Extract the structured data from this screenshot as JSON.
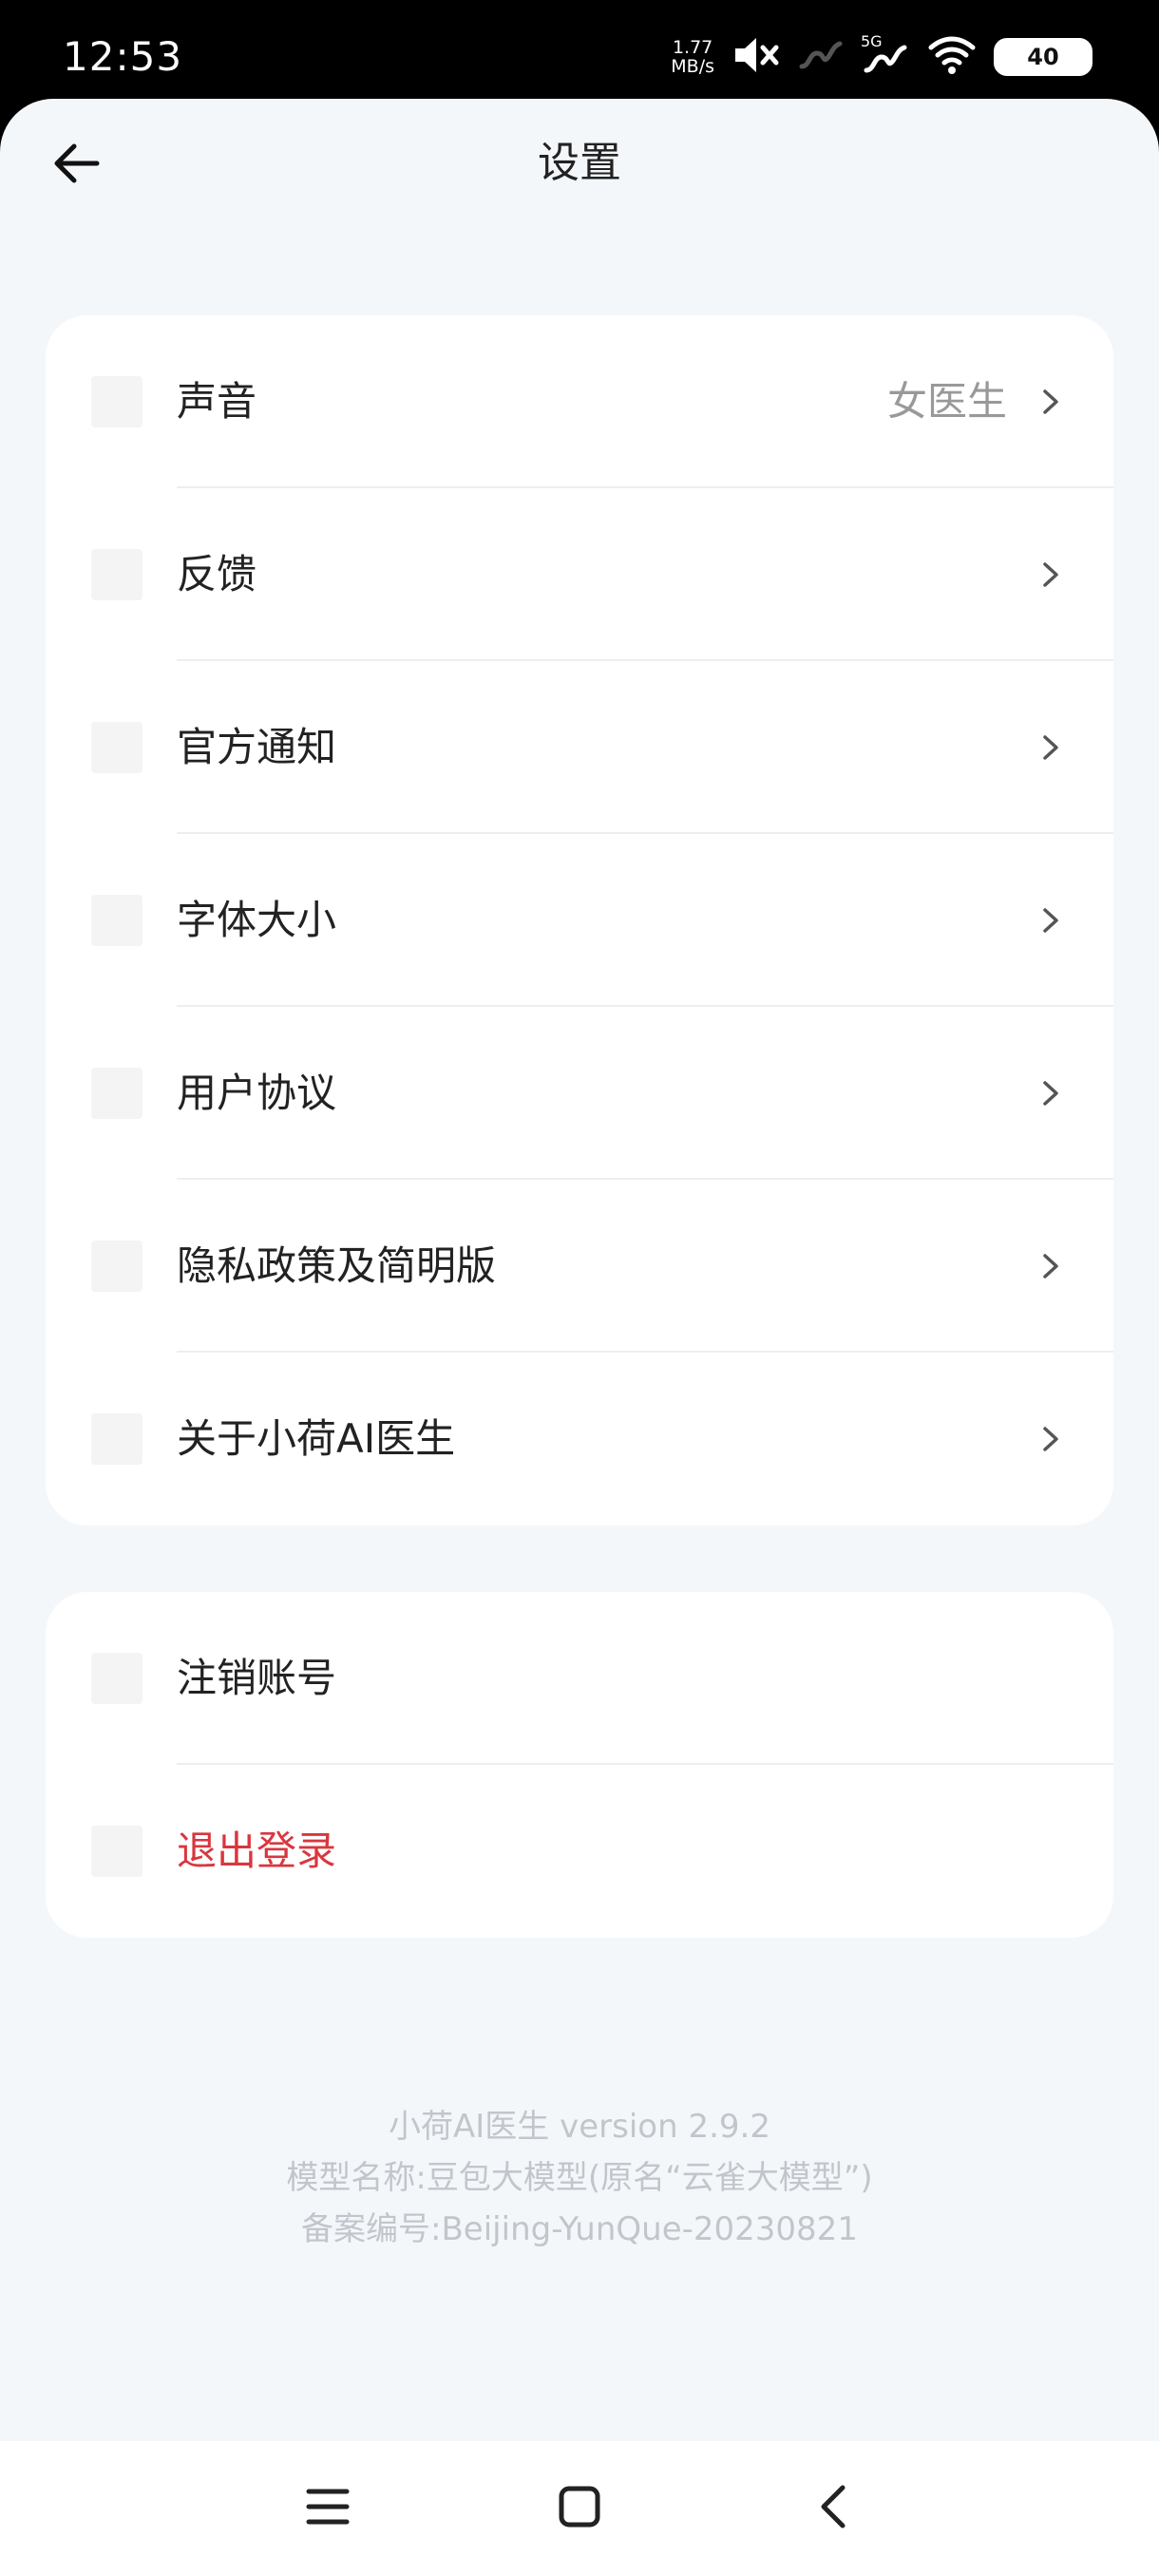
{
  "status_bar": {
    "time": "12:53",
    "net_speed_value": "1.77",
    "net_speed_unit": "MB/s",
    "network_type": "5G",
    "battery": "40"
  },
  "header": {
    "title": "设置"
  },
  "settings_group_1": [
    {
      "label": "声音",
      "value": "女医生"
    },
    {
      "label": "反馈"
    },
    {
      "label": "官方通知"
    },
    {
      "label": "字体大小"
    },
    {
      "label": "用户协议"
    },
    {
      "label": "隐私政策及简明版"
    },
    {
      "label": "关于小荷AI医生"
    }
  ],
  "settings_group_2": [
    {
      "label": "注销账号"
    },
    {
      "label": "退出登录"
    }
  ],
  "footer": {
    "version": "小荷AI医生 version 2.9.2",
    "model_name": "模型名称:豆包大模型(原名“云雀大模型”)",
    "record_number": "备案编号:Beijing-YunQue-20230821"
  },
  "colors": {
    "background": "#f4f7fa",
    "card": "#ffffff",
    "text_primary": "#222222",
    "text_secondary": "#999999",
    "danger": "#d9363e",
    "footer_text": "#c2c6cc"
  },
  "icons": {
    "back": "arrow-left-icon",
    "row_chevron": "chevron-right-icon",
    "nav_menu": "menu-icon",
    "nav_home": "home-square-icon",
    "nav_back": "chevron-left-icon"
  }
}
